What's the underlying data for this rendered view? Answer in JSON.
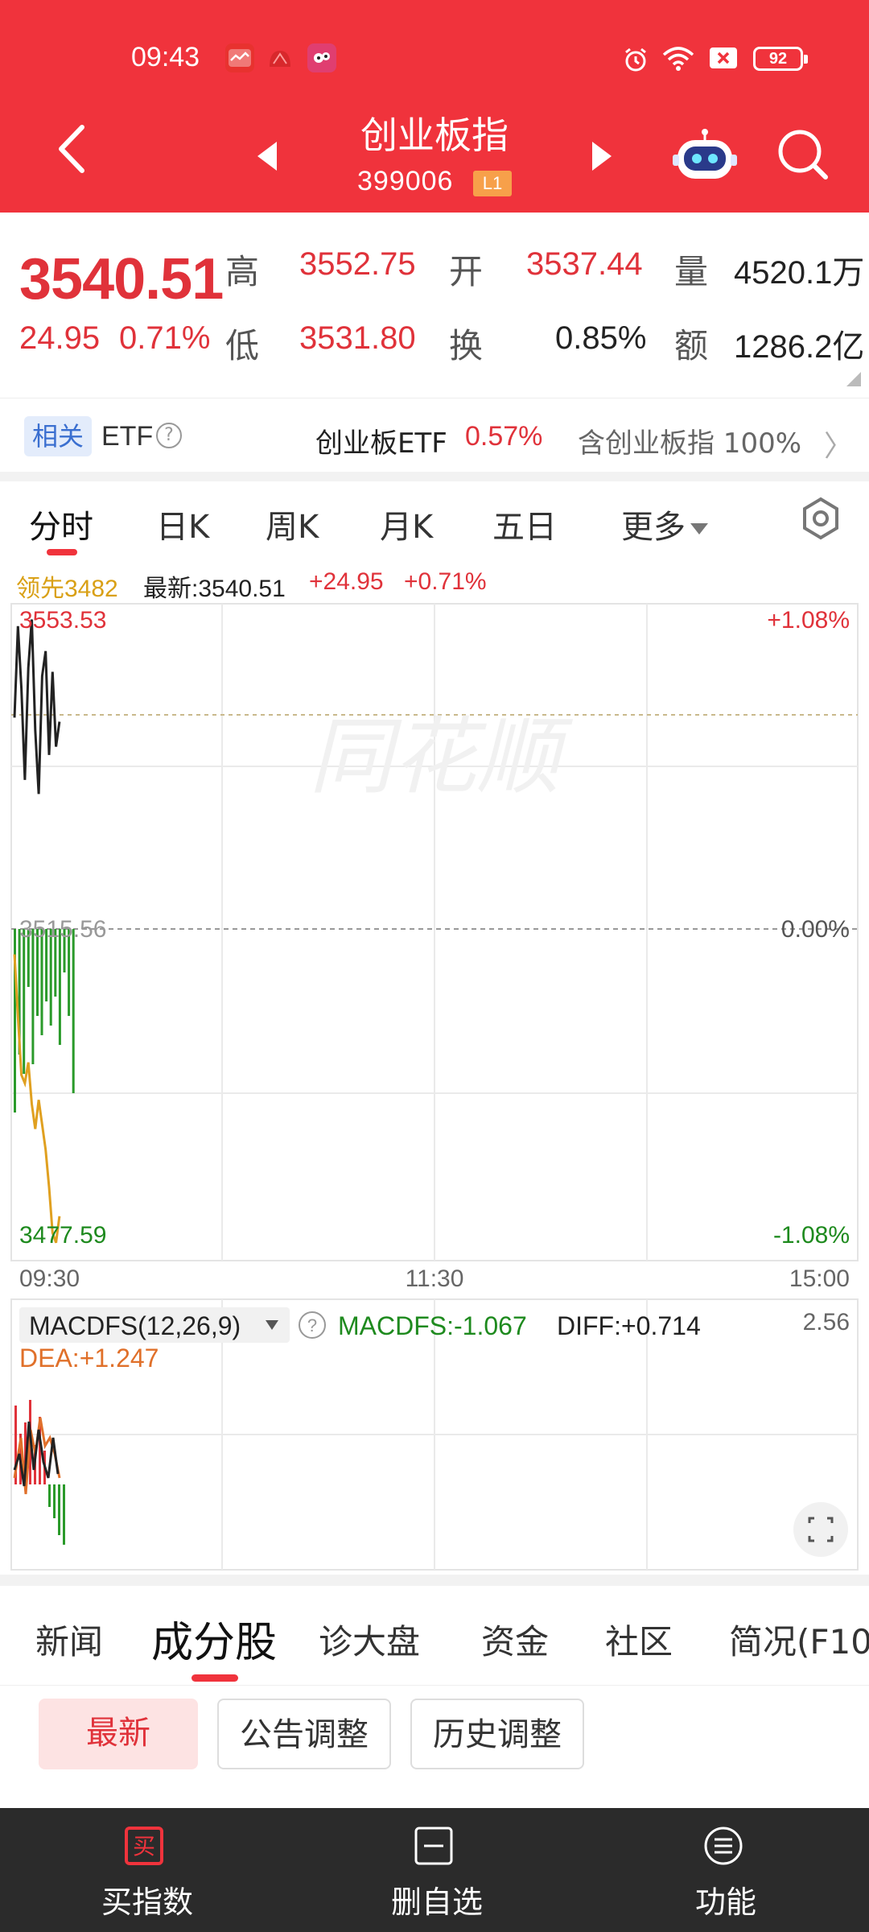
{
  "status_bar": {
    "time": "09:43",
    "battery": "92"
  },
  "header": {
    "title": "创业板指",
    "code": "399006",
    "level_badge": "L1"
  },
  "quote": {
    "price": "3540.51",
    "change": "24.95",
    "change_pct": "0.71%",
    "high_label": "高",
    "high_value": "3552.75",
    "open_label": "开",
    "open_value": "3537.44",
    "volume_label": "量",
    "volume_value": "4520.1万",
    "low_label": "低",
    "low_value": "3531.80",
    "turnover_label": "换",
    "turnover_value": "0.85%",
    "amount_label": "额",
    "amount_value": "1286.2亿"
  },
  "etf": {
    "tag": "相关",
    "label": "ETF",
    "help": "?",
    "name": "创业板ETF",
    "pct": "0.57%",
    "contains": "含创业板指 100%",
    "arrow": "〉"
  },
  "tabs": [
    "分时",
    "日K",
    "周K",
    "月K",
    "五日",
    "更多"
  ],
  "legend": {
    "leading": "领先3482",
    "latest": "最新:3540.51",
    "change": "+24.95",
    "pct": "+0.71%"
  },
  "chart_labels": {
    "price_high": "3553.53",
    "pct_high": "+1.08%",
    "price_mid": "3515.56",
    "pct_mid": "0.00%",
    "price_low": "3477.59",
    "pct_low": "-1.08%",
    "time_start": "09:30",
    "time_mid": "11:30",
    "time_end": "15:00",
    "watermark": "同花顺"
  },
  "macd": {
    "name": "MACDFS(12,26,9)",
    "macdfs": "MACDFS:-1.067",
    "diff": "DIFF:+0.714",
    "dea": "DEA:+1.247",
    "top_value": "2.56"
  },
  "chart_data": {
    "type": "line",
    "title": "",
    "x_range": [
      "09:30",
      "15:00"
    ],
    "price_axis": {
      "min": 3477.59,
      "prev_close": 3515.56,
      "max": 3553.53
    },
    "pct_axis": {
      "min": "-1.08%",
      "max": "+1.08%"
    },
    "series": [
      {
        "name": "",
        "color": "#222222",
        "time": [
          "09:30",
          "09:31",
          "09:32",
          "09:33",
          "09:34",
          "09:35",
          "09:36",
          "09:37",
          "09:38",
          "09:39",
          "09:40",
          "09:41",
          "09:42",
          "09:43"
        ],
        "values": [
          3541.0,
          3552.0,
          3544.5,
          3533.5,
          3547.0,
          3552.8,
          3539.5,
          3531.8,
          3546.0,
          3549.0,
          3536.5,
          3546.5,
          3537.5,
          3540.5
        ]
      },
      {
        "name": "领先",
        "color": "#e0a020",
        "time": [
          "09:30",
          "09:31",
          "09:32",
          "09:33",
          "09:34",
          "09:35",
          "09:36",
          "09:37",
          "09:38",
          "09:39",
          "09:40",
          "09:41",
          "09:42",
          "09:43"
        ],
        "values": [
          3512.5,
          3505.0,
          3498.0,
          3497.0,
          3499.5,
          3494.5,
          3491.5,
          3495.0,
          3492.0,
          3489.0,
          3484.5,
          3479.0,
          3477.8,
          3481.0
        ]
      }
    ],
    "volume_bars": [
      38,
      26,
      30,
      12,
      28,
      18,
      22,
      15,
      20,
      14,
      24,
      9,
      18,
      34
    ],
    "macd_hist": [
      1.4,
      0.9,
      1.1,
      1.5,
      0.7,
      1.2,
      0.6,
      -0.4,
      -0.6,
      -0.9,
      -1.07
    ]
  },
  "bottom_tabs": [
    "新闻",
    "成分股",
    "诊大盘",
    "资金",
    "社区",
    "简况(F10)"
  ],
  "chips": [
    "最新",
    "公告调整",
    "历史调整"
  ],
  "bottom_bar": {
    "buy_icon_text": "买",
    "buy": "买指数",
    "delete": "删自选",
    "function": "功能"
  }
}
